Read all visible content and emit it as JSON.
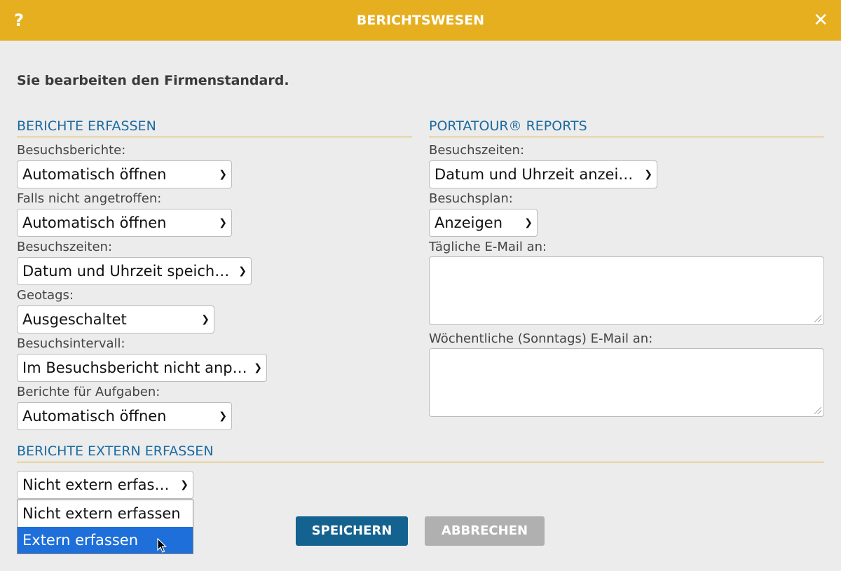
{
  "dialog": {
    "title": "BERICHTSWESEN",
    "help_symbol": "?",
    "close_symbol": "✕"
  },
  "notice": "Sie bearbeiten den Firmenstandard.",
  "left_section": {
    "heading": "BERICHTE ERFASSEN",
    "fields": [
      {
        "label": "Besuchsberichte:",
        "value": "Automatisch öffnen"
      },
      {
        "label": "Falls nicht angetroffen:",
        "value": "Automatisch öffnen"
      },
      {
        "label": "Besuchszeiten:",
        "value": "Datum und Uhrzeit speichern"
      },
      {
        "label": "Geotags:",
        "value": "Ausgeschaltet"
      },
      {
        "label": "Besuchsintervall:",
        "value": "Im Besuchsbericht nicht anpassen"
      },
      {
        "label": "Berichte für Aufgaben:",
        "value": "Automatisch öffnen"
      }
    ]
  },
  "right_section": {
    "heading": "PORTATOUR® REPORTS",
    "visit_times_label": "Besuchszeiten:",
    "visit_times_value": "Datum und Uhrzeit anzeigen",
    "visit_plan_label": "Besuchsplan:",
    "visit_plan_value": "Anzeigen",
    "daily_email_label": "Tägliche E-Mail an:",
    "daily_email_value": "",
    "weekly_email_label": "Wöchentliche (Sonntags) E-Mail an:",
    "weekly_email_value": ""
  },
  "external_section": {
    "heading": "BERICHTE EXTERN ERFASSEN",
    "value": "Nicht extern erfassen",
    "options": [
      "Nicht extern erfassen",
      "Extern erfassen"
    ],
    "highlighted_option": "Extern erfassen"
  },
  "buttons": {
    "save": "SPEICHERN",
    "cancel": "ABBRECHEN"
  },
  "colors": {
    "titlebar": "#e5af20",
    "heading": "#1a6aa0",
    "divider": "#d9a826",
    "save_button": "#13628f",
    "cancel_button": "#b0b0b0",
    "option_highlight": "#1e6fd9"
  }
}
